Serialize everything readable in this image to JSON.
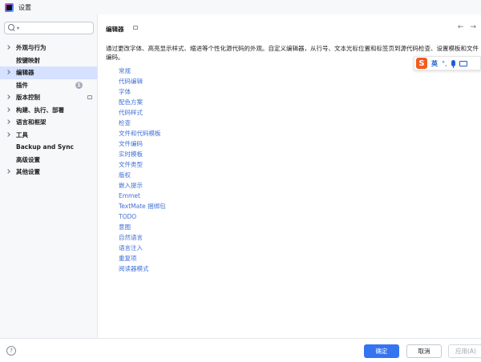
{
  "window": {
    "title": "设置"
  },
  "search": {
    "value": "",
    "placeholder": ""
  },
  "sidebar": {
    "items": [
      {
        "label": "外观与行为",
        "chevron": true
      },
      {
        "label": "按键映射",
        "chevron": false
      },
      {
        "label": "编辑器",
        "chevron": true,
        "selected": true
      },
      {
        "label": "插件",
        "chevron": false,
        "badge": "1"
      },
      {
        "label": "版本控制",
        "chevron": true
      },
      {
        "label": "构建、执行、部署",
        "chevron": true
      },
      {
        "label": "语言和框架",
        "chevron": true
      },
      {
        "label": "工具",
        "chevron": true
      },
      {
        "label": "Backup and Sync",
        "chevron": false
      },
      {
        "label": "高级设置",
        "chevron": false
      },
      {
        "label": "其他设置",
        "chevron": true
      }
    ]
  },
  "main": {
    "title": "编辑器",
    "description": "通过更改字体、高亮显示样式、缩进等个性化源代码的外观。自定义编辑器，从行号、文本光标位置和标签页到源代码检查、设置模板和文件编码。",
    "back_arrow": "←",
    "forward_arrow": "→",
    "links": [
      "常规",
      "代码编辑",
      "字体",
      "配色方案",
      "代码样式",
      "检查",
      "文件和代码模板",
      "文件编码",
      "实时模板",
      "文件类型",
      "版权",
      "嵌入提示",
      "Emmet",
      "TextMate 捆绑包",
      "TODO",
      "意图",
      "自然语言",
      "语言注入",
      "重复项",
      "阅读器模式"
    ]
  },
  "ime": {
    "logo": "S",
    "lang": "英",
    "punct": "°,"
  },
  "footer": {
    "help": "?",
    "ok": "确定",
    "cancel": "取消",
    "apply": "应用(A)"
  },
  "colors": {
    "accent": "#3574f0",
    "link": "#3f6fd8",
    "selected": "#d5e1ff",
    "ime": "#f35b21"
  }
}
